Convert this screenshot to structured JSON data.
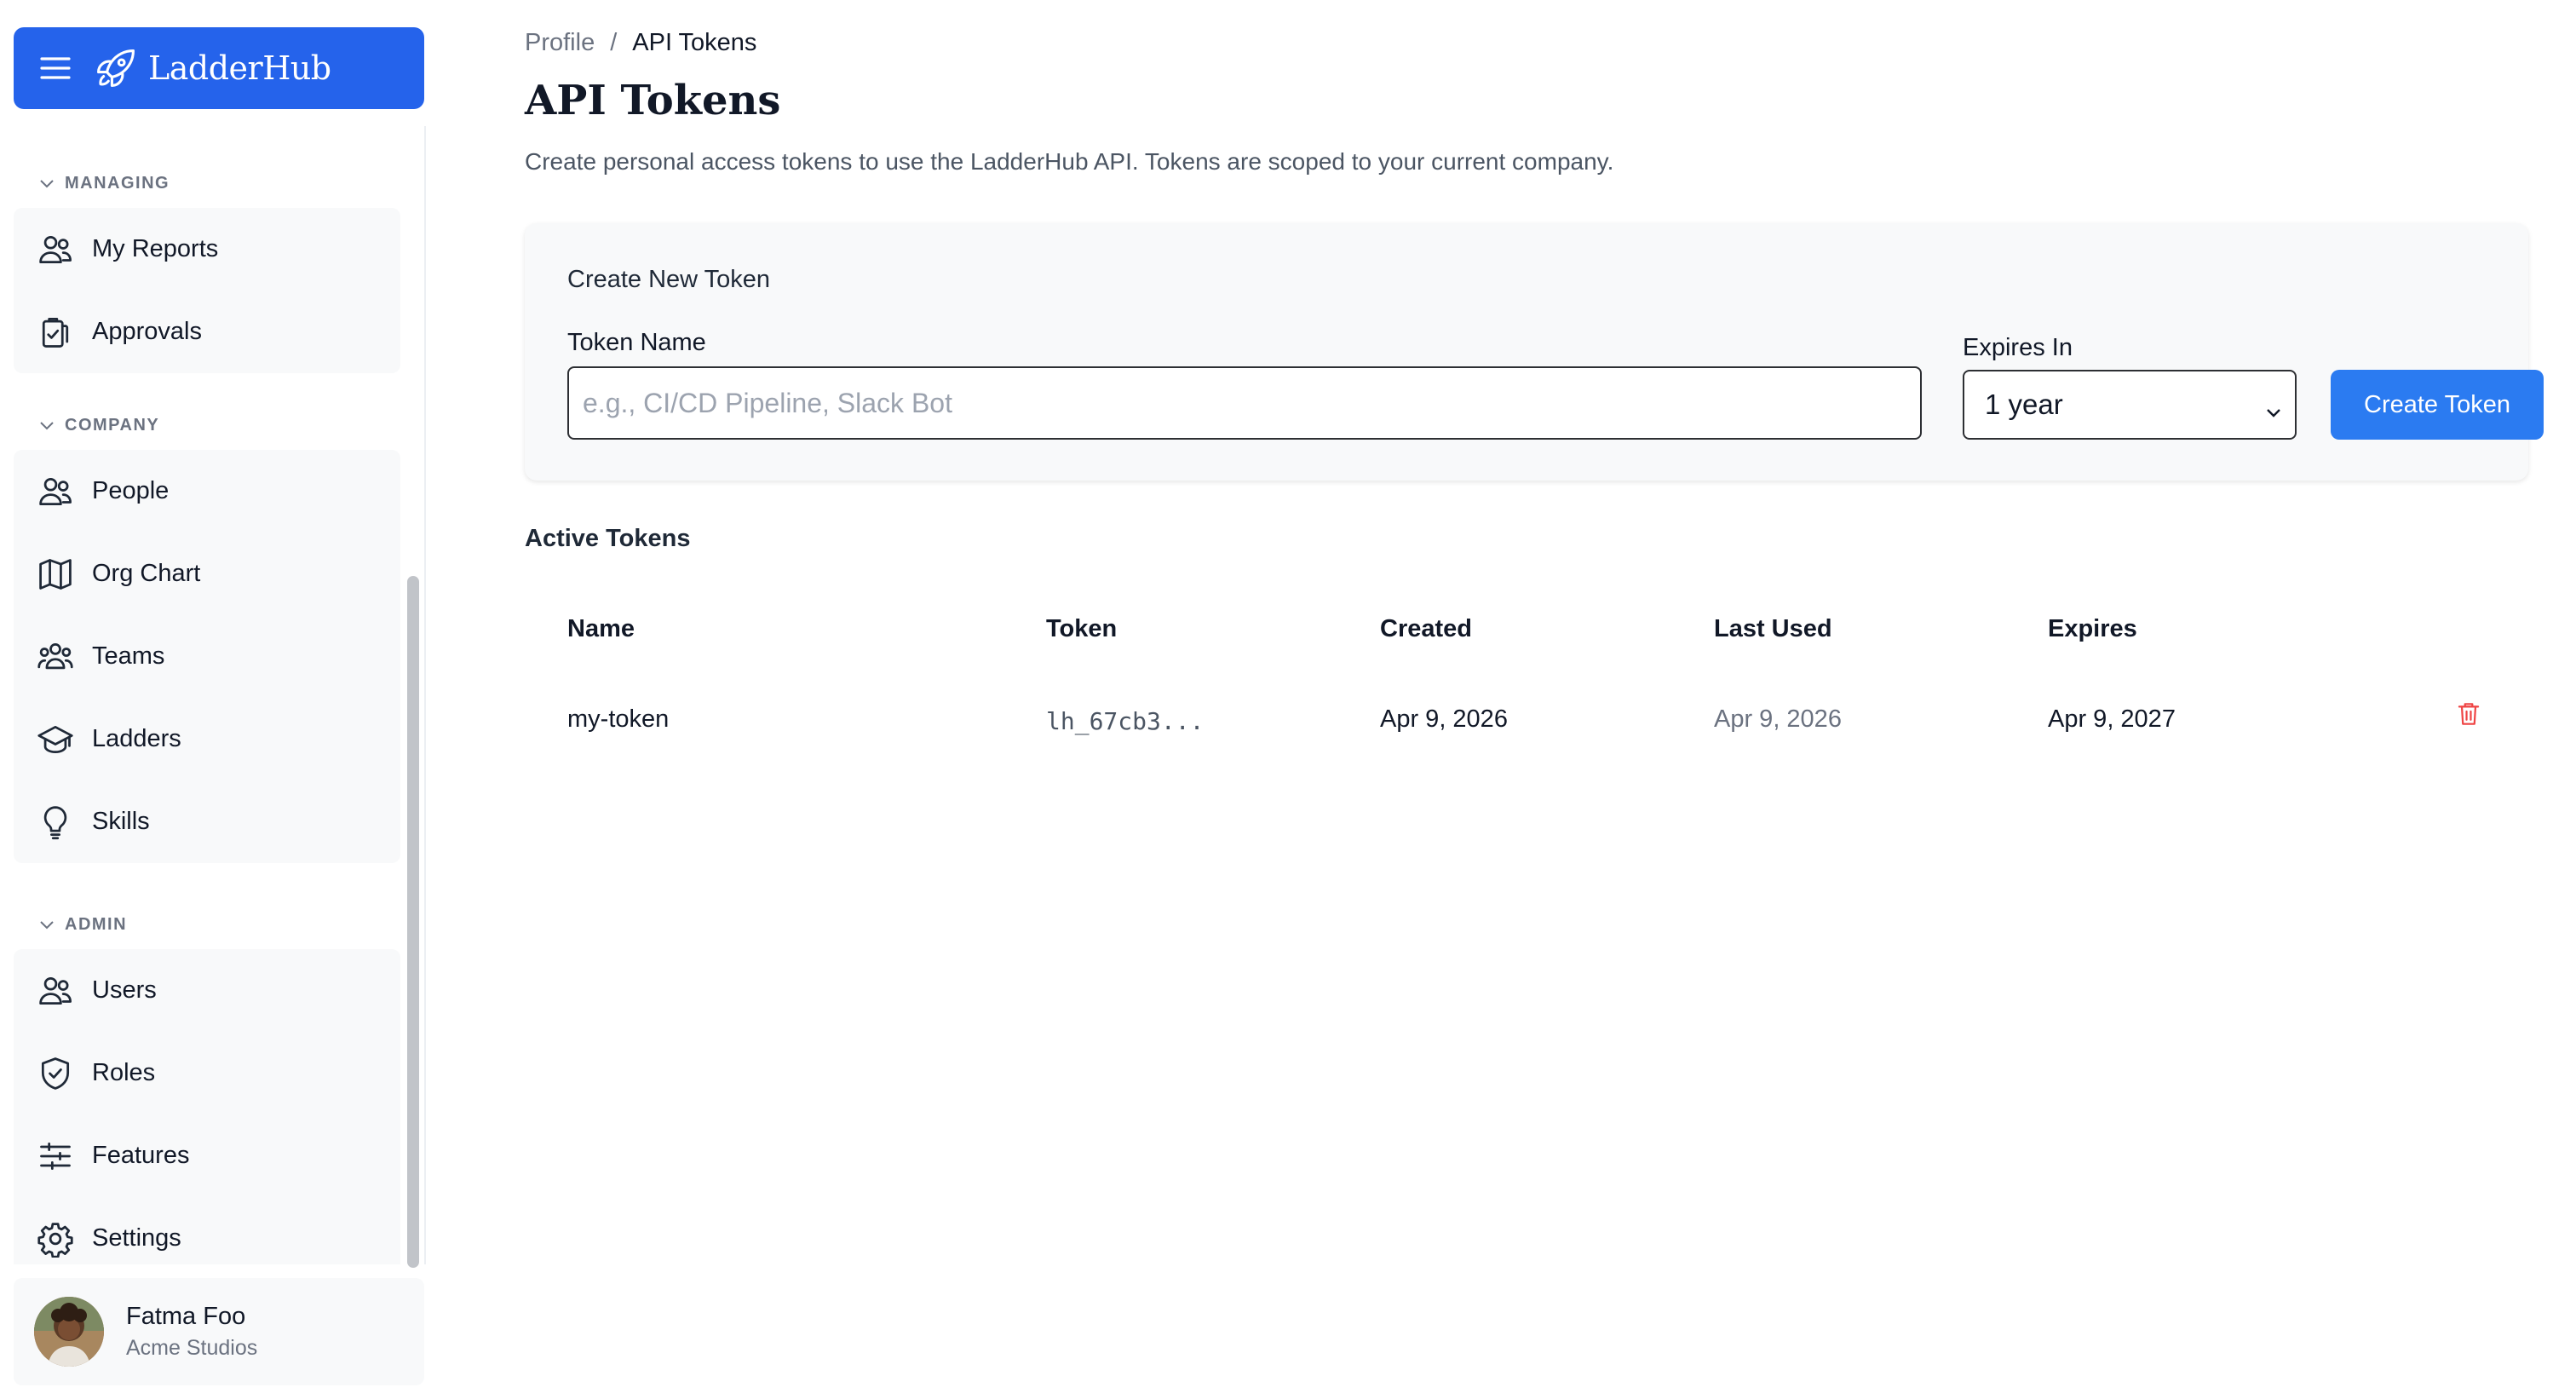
{
  "app": {
    "name": "LadderHub",
    "accent_color": "#2563eb",
    "menu_icon": "hamburger-menu-icon",
    "logo_icon": "rocket-icon"
  },
  "sidebar": {
    "sections": [
      {
        "label": "MANAGING",
        "items": [
          {
            "label": "My Reports",
            "icon": "users-icon"
          },
          {
            "label": "Approvals",
            "icon": "clipboard-check-icon"
          }
        ]
      },
      {
        "label": "COMPANY",
        "items": [
          {
            "label": "People",
            "icon": "users-icon"
          },
          {
            "label": "Org Chart",
            "icon": "map-icon"
          },
          {
            "label": "Teams",
            "icon": "user-group-icon"
          },
          {
            "label": "Ladders",
            "icon": "graduation-cap-icon"
          },
          {
            "label": "Skills",
            "icon": "lightbulb-icon"
          }
        ]
      },
      {
        "label": "ADMIN",
        "items": [
          {
            "label": "Users",
            "icon": "users-icon"
          },
          {
            "label": "Roles",
            "icon": "shield-check-icon"
          },
          {
            "label": "Features",
            "icon": "sliders-icon"
          },
          {
            "label": "Settings",
            "icon": "gear-icon"
          }
        ]
      }
    ],
    "user": {
      "name": "Fatma Foo",
      "company": "Acme Studios"
    }
  },
  "breadcrumb": {
    "parent": "Profile",
    "separator": "/",
    "current": "API Tokens"
  },
  "page": {
    "title": "API Tokens",
    "description": "Create personal access tokens to use the LadderHub API. Tokens are scoped to your current company."
  },
  "create_form": {
    "title": "Create New Token",
    "name_label": "Token Name",
    "name_value": "",
    "name_placeholder": "e.g., CI/CD Pipeline, Slack Bot",
    "expires_label": "Expires In",
    "expires_value": "1 year",
    "submit_label": "Create Token"
  },
  "tokens": {
    "heading": "Active Tokens",
    "columns": [
      "Name",
      "Token",
      "Created",
      "Last Used",
      "Expires"
    ],
    "rows": [
      {
        "name": "my-token",
        "token": "lh_67cb3...",
        "created": "Apr 9, 2026",
        "last_used": "Apr 9, 2026",
        "expires": "Apr 9, 2027",
        "delete_icon": "trash-icon",
        "delete_color": "#ef4444"
      }
    ]
  }
}
